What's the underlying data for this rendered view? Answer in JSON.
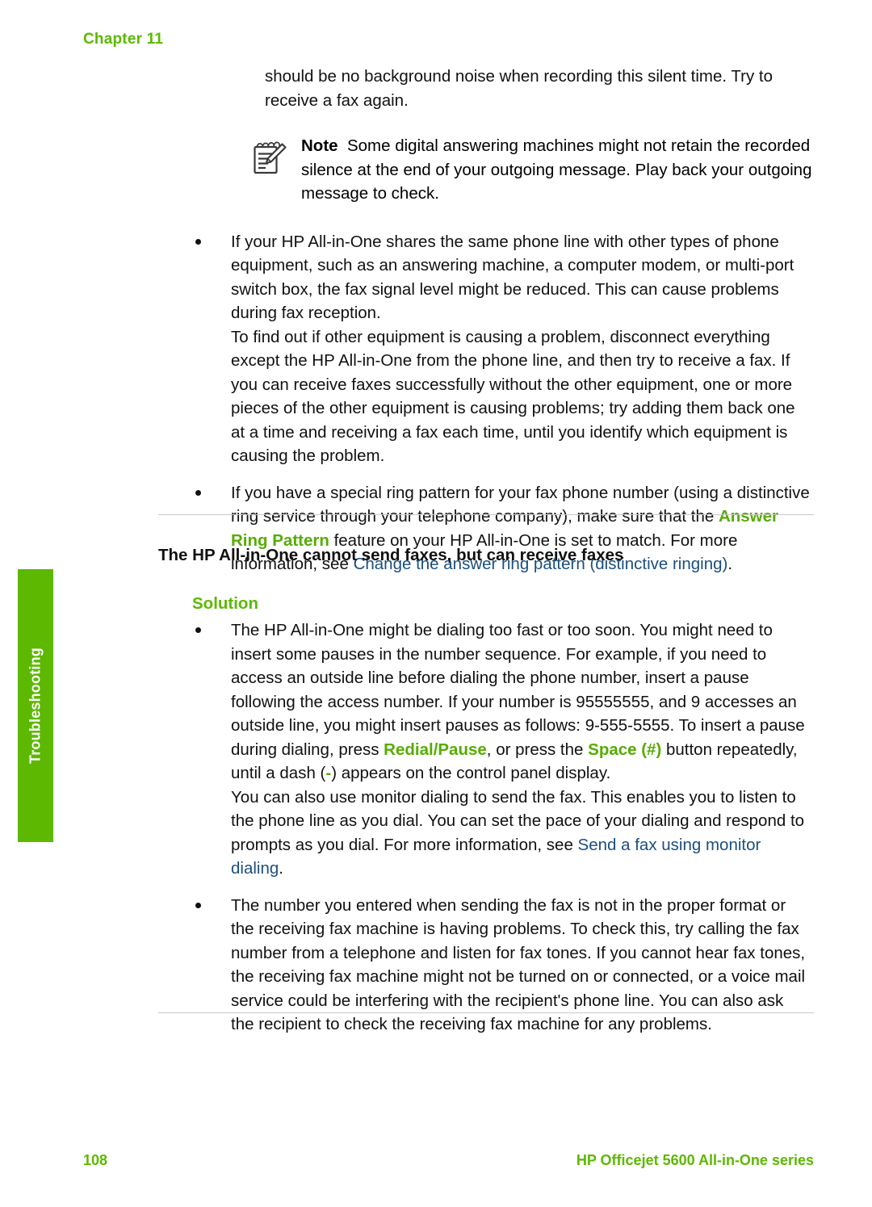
{
  "header": {
    "chapter_label": "Chapter 11"
  },
  "side_tab": {
    "label": "Troubleshooting",
    "color": "#5cb800"
  },
  "intro": {
    "paragraph": "should be no background noise when recording this silent time. Try to receive a fax again."
  },
  "note": {
    "icon": "note-pad-pencil-icon",
    "label": "Note",
    "text": "Some digital answering machines might not retain the recorded silence at the end of your outgoing message. Play back your outgoing message to check."
  },
  "bullets_top": [
    {
      "paragraphs": [
        "If your HP All-in-One shares the same phone line with other types of phone equipment, such as an answering machine, a computer modem, or multi-port switch box, the fax signal level might be reduced. This can cause problems during fax reception.",
        "To find out if other equipment is causing a problem, disconnect everything except the HP All-in-One from the phone line, and then try to receive a fax. If you can receive faxes successfully without the other equipment, one or more pieces of the other equipment is causing problems; try adding them back one at a time and receiving a fax each time, until you identify which equipment is causing the problem."
      ]
    },
    {
      "rich": {
        "part1": "If you have a special ring pattern for your fax phone number (using a distinctive ring service through your telephone company), make sure that the ",
        "ui_term": "Answer Ring Pattern",
        "part2": " feature on your HP All-in-One is set to match. For more information, see ",
        "link": "Change the answer ring pattern (distinctive ringing)",
        "part3": "."
      }
    }
  ],
  "section": {
    "heading": "The HP All-in-One cannot send faxes, but can receive faxes",
    "solution_label": "Solution"
  },
  "bullets_solution": [
    {
      "p1_a": "The HP All-in-One might be dialing too fast or too soon. You might need to insert some pauses in the number sequence. For example, if you need to access an outside line before dialing the phone number, insert a pause following the access number. If your number is 95555555, and 9 accesses an outside line, you might insert pauses as follows: 9-555-5555. To insert a pause during dialing, press ",
      "p1_btn1": "Redial/Pause",
      "p1_b": ", or press the ",
      "p1_btn2": "Space (#)",
      "p1_c": " button repeatedly, until a dash (",
      "p1_dash": "-",
      "p1_d": ") appears on the control panel display.",
      "p2_a": "You can also use monitor dialing to send the fax. This enables you to listen to the phone line as you dial. You can set the pace of your dialing and respond to prompts as you dial. For more information, see ",
      "p2_link": "Send a fax using monitor dialing",
      "p2_b": "."
    },
    {
      "paragraph": "The number you entered when sending the fax is not in the proper format or the receiving fax machine is having problems. To check this, try calling the fax number from a telephone and listen for fax tones. If you cannot hear fax tones, the receiving fax machine might not be turned on or connected, or a voice mail service could be interfering with the recipient's phone line. You can also ask the recipient to check the receiving fax machine for any problems."
    }
  ],
  "footer": {
    "page_number": "108",
    "product": "HP Officejet 5600 All-in-One series"
  },
  "colors": {
    "brand_green": "#5cb800",
    "link_blue": "#1b4f7d",
    "rule_gray": "#c9c9c9"
  }
}
